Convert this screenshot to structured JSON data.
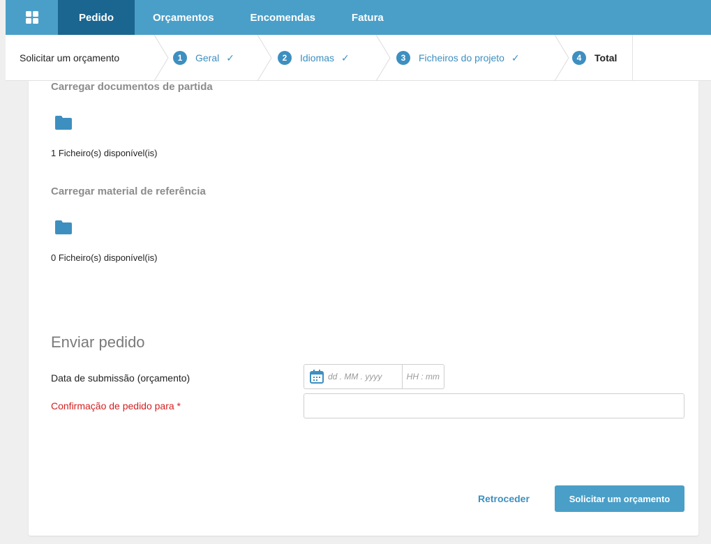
{
  "nav": {
    "tabs": [
      {
        "label": "Pedido",
        "active": true
      },
      {
        "label": "Orçamentos"
      },
      {
        "label": "Encomendas"
      },
      {
        "label": "Fatura"
      }
    ]
  },
  "wizard": {
    "start_label": "Solicitar um orçamento",
    "steps": [
      {
        "number": "1",
        "label": "Geral",
        "done": true
      },
      {
        "number": "2",
        "label": "Idiomas",
        "done": true
      },
      {
        "number": "3",
        "label": "Ficheiros do projeto",
        "done": true
      },
      {
        "number": "4",
        "label": "Total",
        "current": true
      }
    ],
    "check_glyph": "✓"
  },
  "content": {
    "source_docs": {
      "title": "Carregar documentos de partida",
      "icon": "folder-icon",
      "count_text": "1 Ficheiro(s) disponível(is)"
    },
    "reference": {
      "title": "Carregar material de referência",
      "icon": "folder-icon",
      "count_text": "0 Ficheiro(s) disponível(is)"
    },
    "send": {
      "title": "Enviar pedido",
      "date_label": "Data de submissão (orçamento)",
      "date_placeholder": "dd . MM . yyyy",
      "time_placeholder": "HH : mm",
      "confirm_label": "Confirmação de pedido para *",
      "confirm_value": ""
    },
    "actions": {
      "back_label": "Retroceder",
      "submit_label": "Solicitar um orçamento"
    }
  },
  "colors": {
    "nav_bg": "#4a9fc8",
    "nav_active": "#1b6690",
    "accent": "#3d8fc0",
    "required": "#d42020"
  }
}
